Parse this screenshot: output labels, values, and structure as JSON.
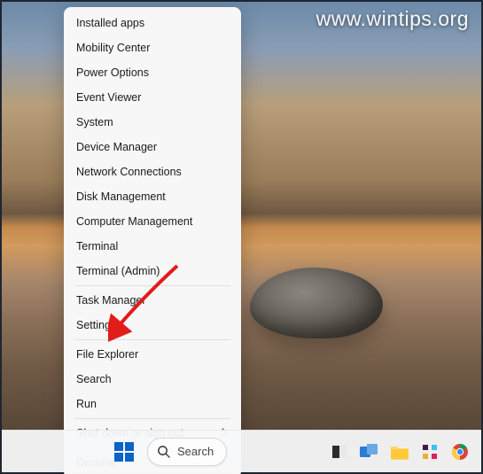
{
  "watermark": "www.wintips.org",
  "menu": {
    "items": [
      "Installed apps",
      "Mobility Center",
      "Power Options",
      "Event Viewer",
      "System",
      "Device Manager",
      "Network Connections",
      "Disk Management",
      "Computer Management",
      "Terminal",
      "Terminal (Admin)"
    ],
    "items2": [
      "Task Manager",
      "Settings"
    ],
    "items3": [
      "File Explorer",
      "Search",
      "Run"
    ],
    "items4": [
      "Shut down or sign out"
    ],
    "items5": [
      "Desktop"
    ]
  },
  "taskbar": {
    "search_label": "Search"
  },
  "highlighted_item": "Settings"
}
